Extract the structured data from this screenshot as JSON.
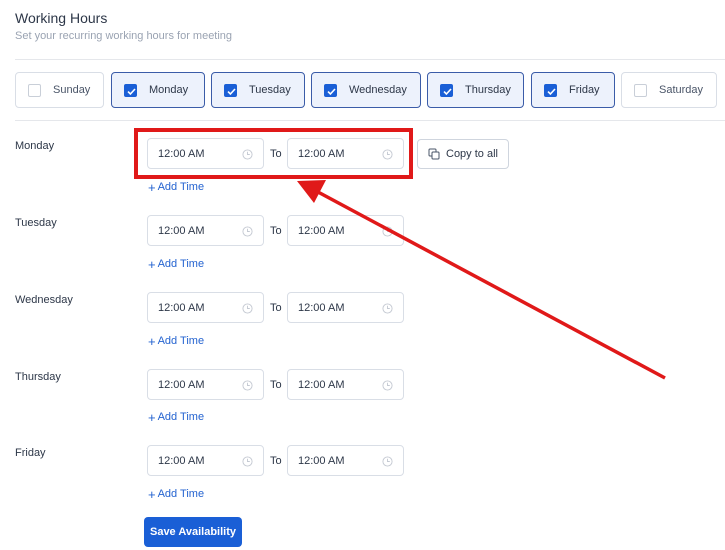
{
  "header": {
    "title": "Working Hours",
    "subtitle": "Set your recurring working hours for meeting"
  },
  "days": [
    {
      "label": "Sunday",
      "checked": false
    },
    {
      "label": "Monday",
      "checked": true
    },
    {
      "label": "Tuesday",
      "checked": true
    },
    {
      "label": "Wednesday",
      "checked": true
    },
    {
      "label": "Thursday",
      "checked": true
    },
    {
      "label": "Friday",
      "checked": true
    },
    {
      "label": "Saturday",
      "checked": false
    }
  ],
  "schedule": [
    {
      "day": "Monday",
      "start": "12:00 AM",
      "end": "12:00 AM"
    },
    {
      "day": "Tuesday",
      "start": "12:00 AM",
      "end": "12:00 AM"
    },
    {
      "day": "Wednesday",
      "start": "12:00 AM",
      "end": "12:00 AM"
    },
    {
      "day": "Thursday",
      "start": "12:00 AM",
      "end": "12:00 AM"
    },
    {
      "day": "Friday",
      "start": "12:00 AM",
      "end": "12:00 AM"
    }
  ],
  "labels": {
    "to": "To",
    "add_time": "Add Time",
    "copy_to_all": "Copy to all",
    "save": "Save Availability"
  },
  "icons": {
    "checkbox": "check-icon",
    "time": "clock-icon",
    "copy": "copy-icon",
    "add": "plus-icon"
  },
  "colors": {
    "accent": "#1a5fd6",
    "link": "#2463d0",
    "annotation": "#e01919"
  }
}
